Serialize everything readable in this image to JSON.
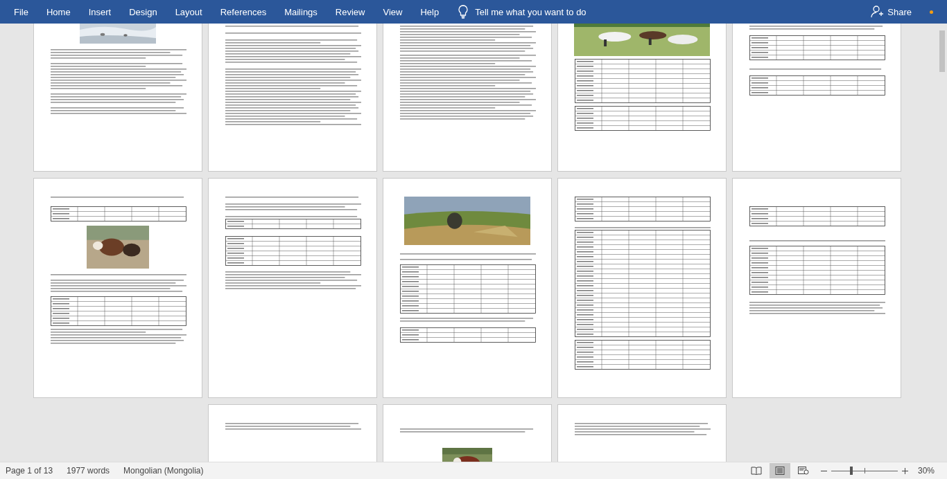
{
  "ribbon": {
    "tabs": [
      {
        "label": "File"
      },
      {
        "label": "Home"
      },
      {
        "label": "Insert"
      },
      {
        "label": "Design"
      },
      {
        "label": "Layout"
      },
      {
        "label": "References"
      },
      {
        "label": "Mailings"
      },
      {
        "label": "Review"
      },
      {
        "label": "View"
      },
      {
        "label": "Help"
      }
    ],
    "tell_me": {
      "placeholder": "Tell me what you want to do"
    },
    "share": "Share"
  },
  "status_bar": {
    "page": "Page 1 of 13",
    "words": "1977 words",
    "language": "Mongolian (Mongolia)",
    "views": [
      {
        "kind": "read",
        "selected": false
      },
      {
        "kind": "print",
        "selected": true
      },
      {
        "kind": "web",
        "selected": false
      }
    ],
    "zoom": {
      "label": "30%",
      "level": 0.3
    }
  }
}
